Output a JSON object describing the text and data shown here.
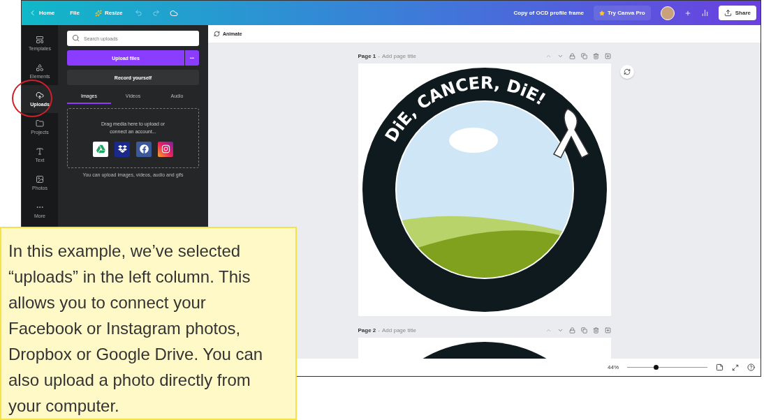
{
  "topbar": {
    "home": "Home",
    "file": "File",
    "resize": "Resize",
    "doc_title": "Copy of OCD profile frame",
    "try_pro": "Try Canva Pro",
    "share": "Share"
  },
  "rail": [
    {
      "label": "Templates",
      "selected": false
    },
    {
      "label": "Elements",
      "selected": false
    },
    {
      "label": "Uploads",
      "selected": true
    },
    {
      "label": "Projects",
      "selected": false
    },
    {
      "label": "Text",
      "selected": false
    },
    {
      "label": "Photos",
      "selected": false
    },
    {
      "label": "More",
      "selected": false
    }
  ],
  "panel": {
    "search": {
      "placeholder": "Search uploads"
    },
    "upload_button": "Upload files",
    "more_button": "•••",
    "record_button": "Record yourself",
    "tabs": [
      {
        "label": "Images",
        "selected": true
      },
      {
        "label": "Videos",
        "selected": false
      },
      {
        "label": "Audio",
        "selected": false
      }
    ],
    "drop_text": "Drag media here to upload or connect an account...",
    "hint": "You can upload images, videos, audio and gifs"
  },
  "canvas": {
    "animate": "Animate",
    "pages": [
      {
        "number": "Page 1",
        "separator": "-",
        "title_placeholder": "Add page title",
        "design_text": "DiE, CANCER, DiE!"
      },
      {
        "number": "Page 2",
        "separator": "-",
        "title_placeholder": "Add page title"
      }
    ],
    "zoom": {
      "reading": "44%",
      "level": 0.36
    }
  },
  "callout": {
    "text": "In this example, we’ve selected “uploads” in the left column. This allows you to connect your Facebook or Instagram photos, Dropbox or Google Drive. You can also upload a photo directly from your computer."
  }
}
